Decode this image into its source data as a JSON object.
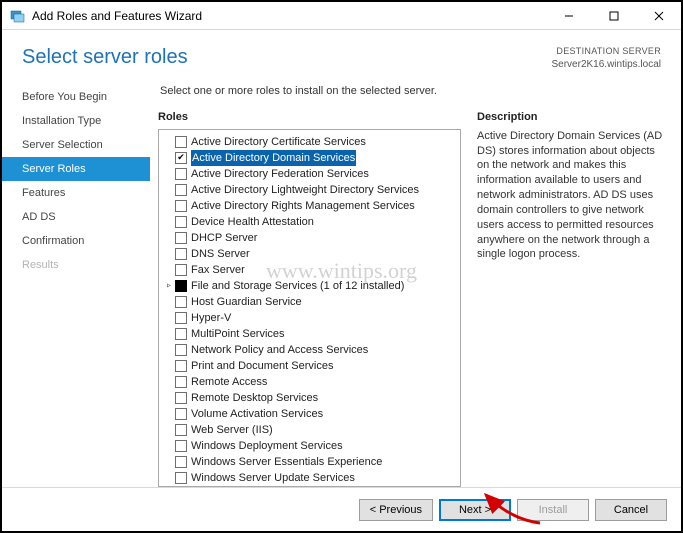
{
  "window": {
    "title": "Add Roles and Features Wizard"
  },
  "header": {
    "page_title": "Select server roles",
    "destination_label": "DESTINATION SERVER",
    "destination_value": "Server2K16.wintips.local"
  },
  "sidebar": {
    "items": [
      {
        "label": "Before You Begin",
        "state": "normal"
      },
      {
        "label": "Installation Type",
        "state": "normal"
      },
      {
        "label": "Server Selection",
        "state": "normal"
      },
      {
        "label": "Server Roles",
        "state": "active"
      },
      {
        "label": "Features",
        "state": "normal"
      },
      {
        "label": "AD DS",
        "state": "normal"
      },
      {
        "label": "Confirmation",
        "state": "normal"
      },
      {
        "label": "Results",
        "state": "disabled"
      }
    ]
  },
  "content": {
    "instruction": "Select one or more roles to install on the selected server.",
    "roles_heading": "Roles",
    "description_heading": "Description",
    "description_text": "Active Directory Domain Services (AD DS) stores information about objects on the network and makes this information available to users and network administrators. AD DS uses domain controllers to give network users access to permitted resources anywhere on the network through a single logon process.",
    "roles": [
      {
        "label": "Active Directory Certificate Services",
        "checked": false,
        "selected": false,
        "expander": ""
      },
      {
        "label": "Active Directory Domain Services",
        "checked": true,
        "selected": true,
        "expander": ""
      },
      {
        "label": "Active Directory Federation Services",
        "checked": false,
        "selected": false,
        "expander": ""
      },
      {
        "label": "Active Directory Lightweight Directory Services",
        "checked": false,
        "selected": false,
        "expander": ""
      },
      {
        "label": "Active Directory Rights Management Services",
        "checked": false,
        "selected": false,
        "expander": ""
      },
      {
        "label": "Device Health Attestation",
        "checked": false,
        "selected": false,
        "expander": ""
      },
      {
        "label": "DHCP Server",
        "checked": false,
        "selected": false,
        "expander": ""
      },
      {
        "label": "DNS Server",
        "checked": false,
        "selected": false,
        "expander": ""
      },
      {
        "label": "Fax Server",
        "checked": false,
        "selected": false,
        "expander": ""
      },
      {
        "label": "File and Storage Services (1 of 12 installed)",
        "checked": "partial",
        "selected": false,
        "expander": "▹"
      },
      {
        "label": "Host Guardian Service",
        "checked": false,
        "selected": false,
        "expander": ""
      },
      {
        "label": "Hyper-V",
        "checked": false,
        "selected": false,
        "expander": ""
      },
      {
        "label": "MultiPoint Services",
        "checked": false,
        "selected": false,
        "expander": ""
      },
      {
        "label": "Network Policy and Access Services",
        "checked": false,
        "selected": false,
        "expander": ""
      },
      {
        "label": "Print and Document Services",
        "checked": false,
        "selected": false,
        "expander": ""
      },
      {
        "label": "Remote Access",
        "checked": false,
        "selected": false,
        "expander": ""
      },
      {
        "label": "Remote Desktop Services",
        "checked": false,
        "selected": false,
        "expander": ""
      },
      {
        "label": "Volume Activation Services",
        "checked": false,
        "selected": false,
        "expander": ""
      },
      {
        "label": "Web Server (IIS)",
        "checked": false,
        "selected": false,
        "expander": ""
      },
      {
        "label": "Windows Deployment Services",
        "checked": false,
        "selected": false,
        "expander": ""
      },
      {
        "label": "Windows Server Essentials Experience",
        "checked": false,
        "selected": false,
        "expander": ""
      },
      {
        "label": "Windows Server Update Services",
        "checked": false,
        "selected": false,
        "expander": ""
      }
    ]
  },
  "footer": {
    "previous": "< Previous",
    "next": "Next >",
    "install": "Install",
    "cancel": "Cancel"
  },
  "watermark": "www.wintips.org"
}
